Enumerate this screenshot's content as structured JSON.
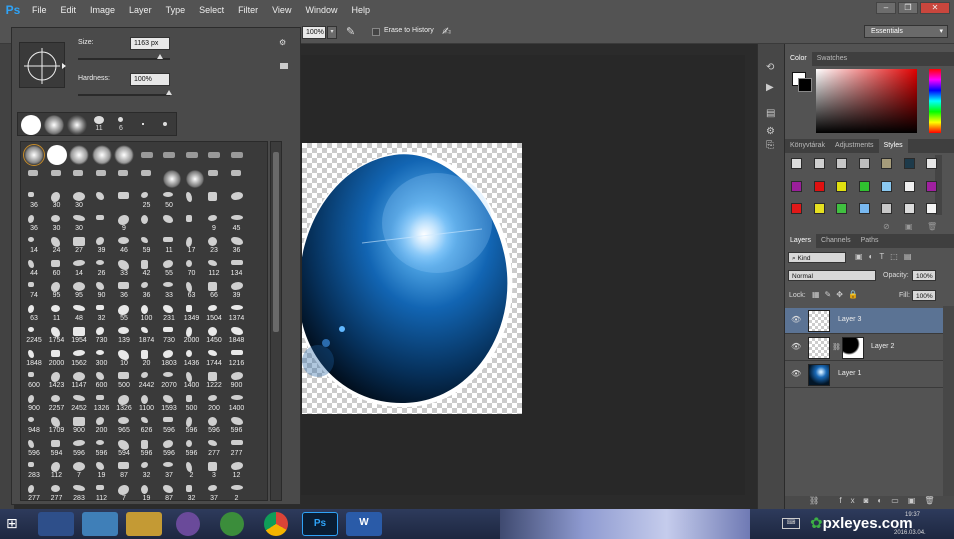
{
  "app": {
    "logo": "Ps"
  },
  "menu": [
    "File",
    "Edit",
    "Image",
    "Layer",
    "Type",
    "Select",
    "Filter",
    "View",
    "Window",
    "Help"
  ],
  "window_controls": {
    "minimize": "‒",
    "restore": "❐",
    "close": "✕"
  },
  "options": {
    "flow": "100%",
    "erase_history": "Erase to History",
    "workspace": "Essentials"
  },
  "brush_popup": {
    "size_label": "Size:",
    "size_value": "1163 px",
    "hardness_label": "Hardness:",
    "hardness_value": "100%",
    "recent": [
      "",
      "",
      "",
      "11",
      "6",
      "",
      ""
    ],
    "rows": [
      [
        "",
        "",
        "",
        "",
        "",
        "",
        "",
        "",
        "",
        ""
      ],
      [
        "",
        "",
        "",
        "",
        "",
        "",
        "",
        "",
        "",
        ""
      ],
      [
        "36",
        "30",
        "30",
        "",
        "",
        "25",
        "50",
        "",
        "",
        ""
      ],
      [
        "36",
        "30",
        "30",
        "",
        "9",
        "",
        "",
        "",
        "9",
        "45"
      ],
      [
        "14",
        "24",
        "27",
        "39",
        "46",
        "59",
        "11",
        "17",
        "23",
        "36"
      ],
      [
        "44",
        "60",
        "14",
        "26",
        "33",
        "42",
        "55",
        "70",
        "112",
        "134"
      ],
      [
        "74",
        "95",
        "95",
        "90",
        "36",
        "36",
        "33",
        "63",
        "66",
        "39"
      ],
      [
        "63",
        "11",
        "48",
        "32",
        "55",
        "100",
        "231",
        "1349",
        "1504",
        "1374"
      ],
      [
        "2245",
        "1754",
        "1954",
        "730",
        "139",
        "1874",
        "730",
        "2000",
        "1450",
        "1848"
      ],
      [
        "1848",
        "2000",
        "1562",
        "300",
        "10",
        "20",
        "1803",
        "1436",
        "1744",
        "1216"
      ],
      [
        "600",
        "1423",
        "1147",
        "600",
        "500",
        "2442",
        "2070",
        "1400",
        "1222",
        "900"
      ],
      [
        "900",
        "2257",
        "2452",
        "1326",
        "1326",
        "1100",
        "1593",
        "500",
        "200",
        "1400"
      ],
      [
        "948",
        "1709",
        "900",
        "200",
        "965",
        "626",
        "596",
        "596",
        "596",
        "596"
      ],
      [
        "596",
        "594",
        "596",
        "596",
        "594",
        "596",
        "596",
        "596",
        "277",
        "277"
      ],
      [
        "283",
        "112",
        "7",
        "19",
        "87",
        "32",
        "37",
        "2",
        "3",
        "12"
      ],
      [
        "277",
        "277",
        "283",
        "112",
        "7",
        "19",
        "87",
        "32",
        "37",
        "2"
      ]
    ]
  },
  "color_panel": {
    "tabs": [
      "Color",
      "Swatches"
    ]
  },
  "styles_panel": {
    "tabs": [
      "Könyvtárak",
      "Adjustments",
      "Styles"
    ]
  },
  "layers_panel": {
    "tabs": [
      "Layers",
      "Channels",
      "Paths"
    ],
    "filter": "Kind",
    "blend_mode": "Normal",
    "opacity_label": "Opacity:",
    "opacity_value": "100%",
    "lock_label": "Lock:",
    "fill_label": "Fill:",
    "fill_value": "100%",
    "layers": [
      {
        "name": "Layer 3",
        "selected": true
      },
      {
        "name": "Layer 2",
        "selected": false
      },
      {
        "name": "Layer 1",
        "selected": false
      }
    ]
  },
  "watermark": "pxleyes.com",
  "clock": {
    "time": "19:37",
    "date": "2016.03.04."
  }
}
